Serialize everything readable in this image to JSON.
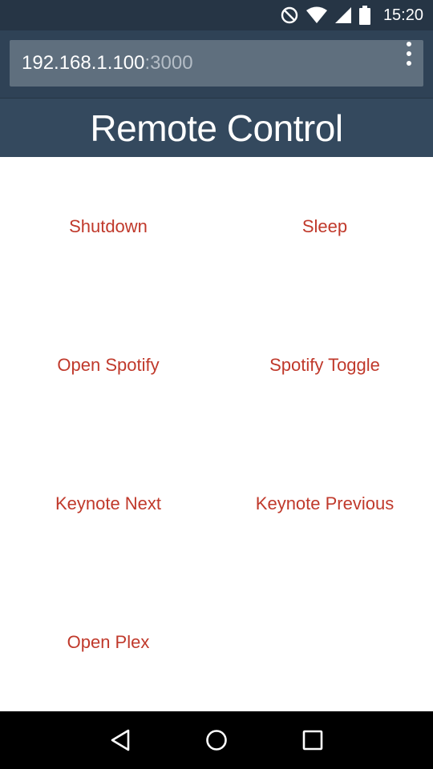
{
  "status_bar": {
    "time": "15:20",
    "icons": [
      "do-not-disturb-icon",
      "wifi-icon",
      "signal-icon",
      "battery-icon"
    ]
  },
  "browser": {
    "url_host": "192.168.1.100",
    "url_port": ":3000",
    "menu_icon": "more-vertical-icon"
  },
  "header": {
    "title": "Remote Control"
  },
  "buttons": [
    {
      "label": "Shutdown"
    },
    {
      "label": "Sleep"
    },
    {
      "label": "Open Spotify"
    },
    {
      "label": "Spotify Toggle"
    },
    {
      "label": "Keynote Next"
    },
    {
      "label": "Keynote Previous"
    },
    {
      "label": "Open Plex"
    }
  ],
  "nav_bar": {
    "icons": [
      "back-icon",
      "home-icon",
      "recents-icon"
    ]
  },
  "colors": {
    "status_bar": "#263545",
    "browser_bar": "#2f4256",
    "url_box": "#5f6f7e",
    "header": "#34495e",
    "button_text": "#c0392b",
    "nav_bar": "#000000"
  }
}
